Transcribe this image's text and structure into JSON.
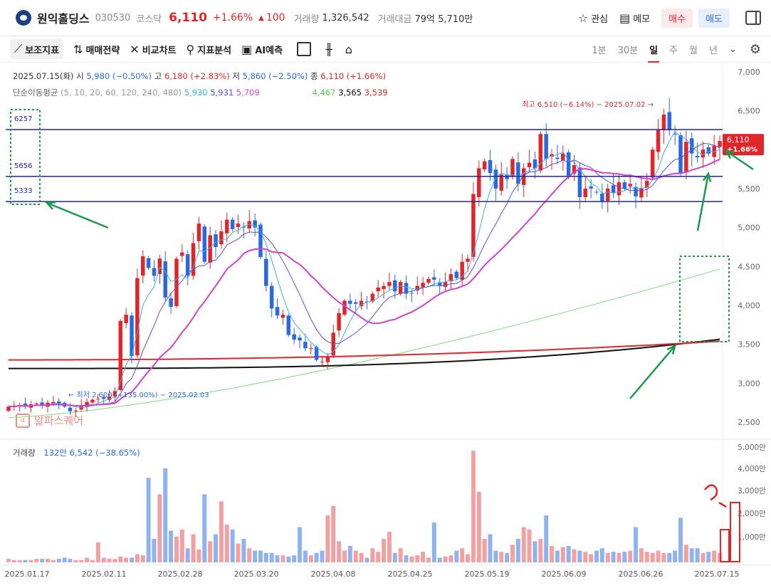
{
  "header": {
    "stock_name": "원익홀딩스",
    "code": "030530",
    "market": "코스닥",
    "price": "6,110",
    "change_pct": "+1.66%",
    "change_arrow": "▲",
    "change_abs": "100",
    "volume_label": "거래량",
    "volume_value": "1,326,542",
    "amount_label": "거래대금",
    "amount_value": "79억 5,710만",
    "watch_label": "관심",
    "memo_label": "메모",
    "buy_label": "매수",
    "sell_label": "매도"
  },
  "toolbar": {
    "indicator_label": "보조지표",
    "strategy_label": "매매전략",
    "compare_label": "비교차트",
    "analysis_label": "지표분석",
    "ai_label": "AI예측",
    "periods": [
      "1분",
      "30분",
      "일",
      "주",
      "월",
      "년"
    ],
    "active_period": "일"
  },
  "ohlc": {
    "date": "2025.07.15(화)",
    "open_label": "시",
    "open": "5,980 (−0.50%)",
    "high_label": "고",
    "high": "6,180 (+2.83%)",
    "low_label": "저",
    "low": "5,860 (−2.50%)",
    "close_label": "종",
    "close": "6,110 (+1.66%)"
  },
  "ma": {
    "label": "단순이동평균",
    "periods": "(5, 10, 20, 60, 120, 240, 480)",
    "values": [
      "5,930",
      "5,931",
      "5,709",
      "4,467",
      "3,565",
      "3,539"
    ],
    "colors": [
      "#3cb1e6",
      "#5a4fe0",
      "#cc44cc",
      "#55c855",
      "#111111",
      "#e0262b"
    ]
  },
  "volume_info": {
    "label": "거래량",
    "value": "132만 6,542 (−38.65%)"
  },
  "watermark": "알파스퀘어",
  "chart_data": {
    "type": "candlestick",
    "y_ticks": [
      "7,000",
      "6,500",
      "6,000",
      "5,500",
      "5,000",
      "4,500",
      "4,000",
      "3,500",
      "3,000",
      "2,500"
    ],
    "ylim": [
      2300,
      7080
    ],
    "vol_ticks": [
      "5,000만",
      "4,000만",
      "3,000만",
      "2,000만",
      "1,000만"
    ],
    "x_labels": [
      "2025.01.17",
      "2025.02.11",
      "2025.02.28",
      "2025.03.20",
      "2025.04.08",
      "2025.04.25",
      "2025.05.19",
      "2025.06.09",
      "2025.06.26",
      "2025.07.15"
    ],
    "current_price_tag": "6,110",
    "current_change_tag": "+1.66%",
    "high_annotation": "최고 6,510 (−6.14%) − 2025.07.02 →",
    "low_annotation": "← 최저 2,600 (+135.00%) − 2025.02.03",
    "horizontal_lines": [
      {
        "label": "6257",
        "value": 6257
      },
      {
        "label": "5656",
        "value": 5656
      },
      {
        "label": "5333",
        "value": 5333
      }
    ],
    "close_series": [
      2700,
      2710,
      2720,
      2700,
      2730,
      2740,
      2720,
      2750,
      2760,
      2730,
      2700,
      2640,
      2650,
      2720,
      2760,
      2790,
      2800,
      2800,
      2830,
      2900,
      3800,
      3880,
      3350,
      4350,
      4630,
      4480,
      4380,
      4600,
      4100,
      3980,
      4600,
      4680,
      4380,
      4800,
      5050,
      4560,
      4900,
      4750,
      4950,
      5100,
      4980,
      5050,
      5000,
      5080,
      5000,
      4620,
      4250,
      3960,
      3870,
      3880,
      3620,
      3560,
      3550,
      3450,
      3450,
      3300,
      3280,
      3350,
      3650,
      3900,
      4060,
      4020,
      4020,
      4060,
      4040,
      4150,
      4230,
      4250,
      4300,
      4180,
      4300,
      4150,
      4160,
      4250,
      4290,
      4340,
      4330,
      4250,
      4300,
      4400,
      4350,
      4560,
      4600,
      5430,
      5760,
      5850,
      5700,
      5500,
      5680,
      5620,
      5880,
      5560,
      5760,
      5830,
      5760,
      6200,
      5880,
      5940,
      5880,
      5950,
      5650,
      5800,
      5390,
      5500,
      5500,
      5450,
      5330,
      5500,
      5440,
      5580,
      5500,
      5560,
      5400,
      5500,
      5600,
      6000,
      6250,
      6450,
      6250,
      6200,
      5700,
      6100,
      5950,
      5900,
      6000,
      5950,
      6050,
      6110
    ],
    "volume_series": [
      3,
      2,
      2,
      2,
      2,
      3,
      3,
      3,
      2,
      3,
      4,
      3,
      2,
      2,
      4,
      2,
      17,
      4,
      3,
      3,
      5,
      4,
      4,
      7,
      6,
      72,
      20,
      58,
      80,
      27,
      22,
      28,
      12,
      24,
      11,
      58,
      18,
      24,
      52,
      32,
      28,
      16,
      20,
      12,
      10,
      10,
      8,
      8,
      6,
      6,
      5,
      6,
      30,
      10,
      6,
      8,
      10,
      40,
      48,
      18,
      10,
      14,
      10,
      8,
      4,
      12,
      9,
      20,
      26,
      8,
      12,
      6,
      5,
      6,
      9,
      4,
      34,
      4,
      5,
      6,
      10,
      12,
      7,
      95,
      60,
      20,
      24,
      10,
      9,
      8,
      15,
      20,
      30,
      28,
      18,
      20,
      40,
      14,
      10,
      13,
      14,
      11,
      10,
      9,
      7,
      10,
      12,
      8,
      9,
      8,
      9,
      10,
      30,
      12,
      9,
      8,
      10,
      8,
      8,
      10,
      38,
      15,
      12,
      12,
      8,
      9,
      10,
      8
    ]
  }
}
